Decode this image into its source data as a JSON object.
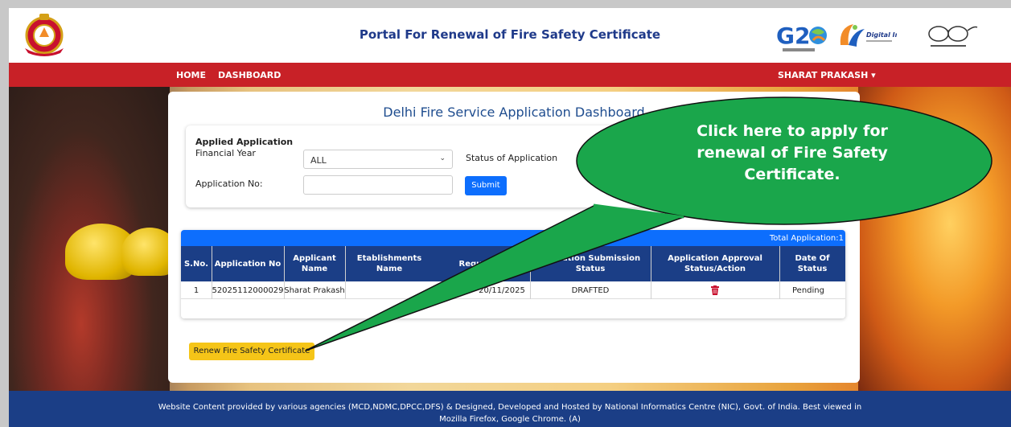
{
  "header": {
    "title": "Portal For Renewal of Fire Safety Certificate",
    "emblem_icon": "delhi-fire-service-emblem-icon",
    "g20_logo_text": "G20",
    "digital_india_logo_text": "Digital India",
    "swachh_bharat_logo_icon": "swachh-bharat-glasses-icon"
  },
  "nav": {
    "home": "HOME",
    "dashboard": "DASHBOARD",
    "user": "SHARAT PRAKASH ▾"
  },
  "dashboard": {
    "title": "Delhi Fire Service Application Dashboard",
    "filters": {
      "heading": "Applied Application",
      "financial_year_label": "Financial Year",
      "financial_year_value": "ALL",
      "status_label": "Status of Application",
      "application_no_label": "Application No:",
      "application_no_value": "",
      "submit_label": "Submit"
    },
    "table": {
      "total_label": "Total Application:1",
      "columns": [
        "S.No.",
        "Application No",
        "Applicant Name",
        "Etablishments Name",
        "Request S",
        "pplication Submission Status",
        "Application Approval Status/Action",
        "Date Of Status"
      ],
      "rows": [
        [
          "1",
          "52025112000029",
          "Sharat Prakash",
          "",
          "20/11/2025",
          "DRAFTED",
          "trash-icon",
          "Pending"
        ]
      ]
    },
    "renew_button": "Renew Fire Safety Certificate"
  },
  "callout": {
    "line1": "Click here to apply for",
    "line2": "renewal of Fire Safety",
    "line3": "Certificate.",
    "color": "#1aa64b"
  },
  "footer": {
    "line1": "Website Content provided by various agencies (MCD,NDMC,DPCC,DFS) & Designed, Developed and Hosted by National Informatics Centre (NIC), Govt. of India. Best viewed in",
    "line2": "Mozilla Firefox, Google Chrome. (A)"
  },
  "colors": {
    "nav_red": "#c82127",
    "navy": "#1b3e86",
    "primary_blue": "#0d6efd",
    "renew_yellow": "#f5c518",
    "callout_green": "#1aa64b"
  }
}
